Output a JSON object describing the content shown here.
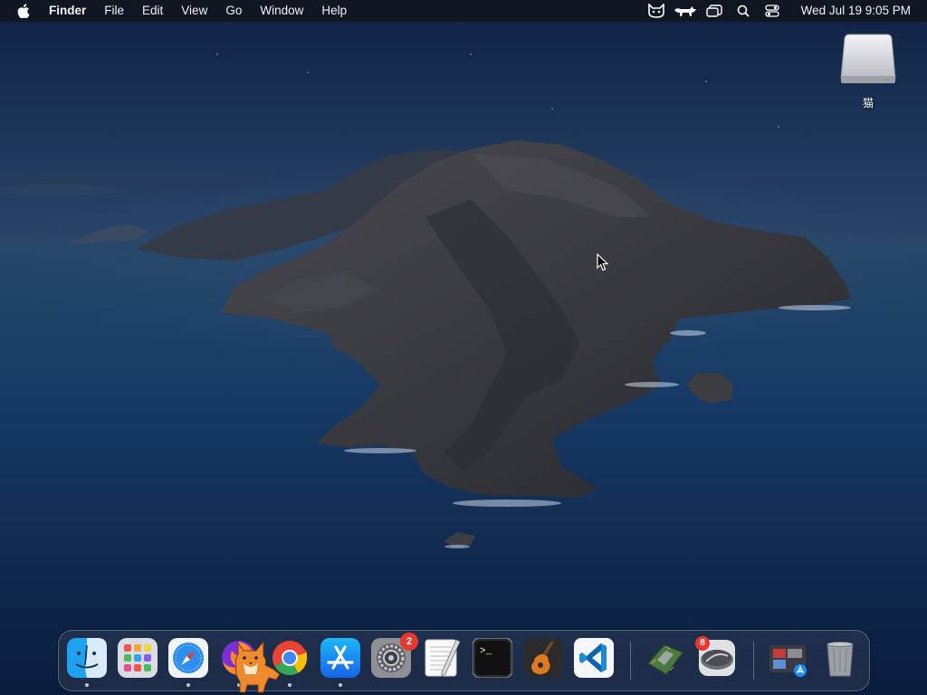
{
  "menubar": {
    "app_name": "Finder",
    "menus": [
      "File",
      "Edit",
      "View",
      "Go",
      "Window",
      "Help"
    ],
    "status_icons": [
      "cat-face-icon",
      "cat-silhouette-icon",
      "window-overview-icon",
      "search-icon",
      "control-center-icon"
    ],
    "clock": "Wed Jul 19  9:05 PM"
  },
  "desktop": {
    "disk_label": "猫"
  },
  "dock": {
    "apps": [
      {
        "name": "finder-icon",
        "running": true
      },
      {
        "name": "launchpad-icon",
        "running": false
      },
      {
        "name": "safari-icon",
        "running": true
      },
      {
        "name": "firefox-icon",
        "running": true
      },
      {
        "name": "chrome-icon",
        "running": true
      },
      {
        "name": "app-store-icon",
        "running": true
      },
      {
        "name": "system-preferences-icon",
        "running": false,
        "badge": "2"
      },
      {
        "name": "textedit-icon",
        "running": false
      },
      {
        "name": "terminal-icon",
        "running": false
      },
      {
        "name": "garageband-icon",
        "running": false
      },
      {
        "name": "vscode-icon",
        "running": false
      },
      {
        "name": "cpu-chip-icon",
        "running": false
      },
      {
        "name": "virtualization-icon",
        "running": false,
        "badge": "8"
      },
      {
        "name": "app-folder-icon",
        "running": false
      },
      {
        "name": "trash-icon",
        "running": false
      }
    ]
  },
  "colors": {
    "sky": "#1a3358",
    "sea": "#0c2247",
    "island": "#3a3c42",
    "badge": "#e8372c"
  }
}
